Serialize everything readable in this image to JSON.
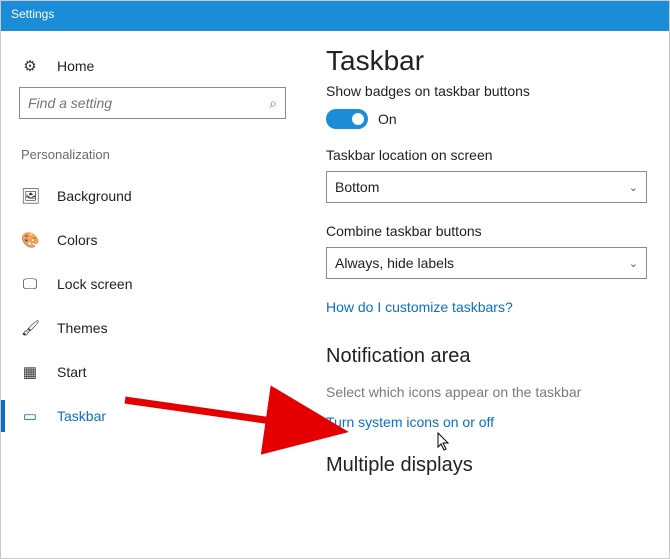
{
  "window": {
    "title": "Settings"
  },
  "sidebar": {
    "home": "Home",
    "search_placeholder": "Find a setting",
    "category": "Personalization",
    "items": [
      {
        "label": "Background"
      },
      {
        "label": "Colors"
      },
      {
        "label": "Lock screen"
      },
      {
        "label": "Themes"
      },
      {
        "label": "Start"
      },
      {
        "label": "Taskbar"
      }
    ]
  },
  "main": {
    "heading": "Taskbar",
    "badges_label": "Show badges on taskbar buttons",
    "badges_state": "On",
    "location_label": "Taskbar location on screen",
    "location_value": "Bottom",
    "combine_label": "Combine taskbar buttons",
    "combine_value": "Always, hide labels",
    "help_link": "How do I customize taskbars?",
    "notif_heading": "Notification area",
    "notif_link1": "Select which icons appear on the taskbar",
    "notif_link2": "Turn system icons on or off",
    "multi_heading": "Multiple displays"
  }
}
